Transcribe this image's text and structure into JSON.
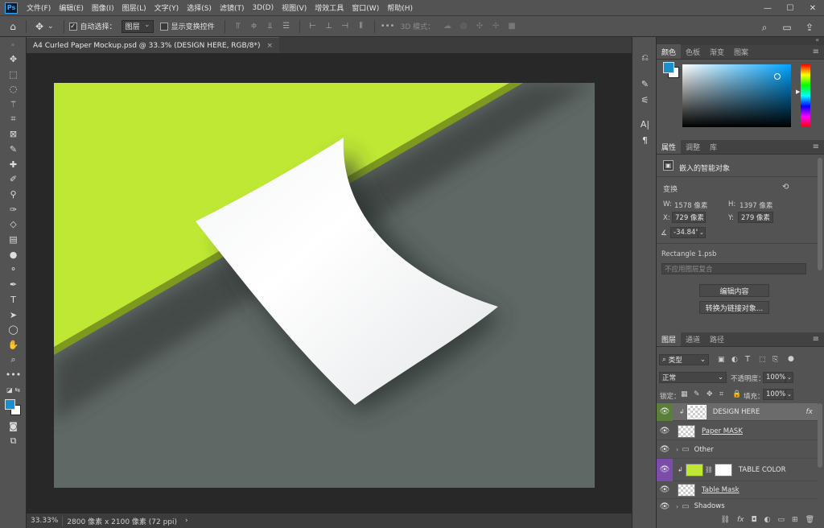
{
  "app": {
    "logo": "Ps"
  },
  "menu": [
    "文件(F)",
    "编辑(E)",
    "图像(I)",
    "图层(L)",
    "文字(Y)",
    "选择(S)",
    "滤镜(T)",
    "3D(D)",
    "视图(V)",
    "增效工具",
    "窗口(W)",
    "帮助(H)"
  ],
  "options": {
    "auto_select_label": "自动选择：",
    "auto_select_value": "图层",
    "show_transform_label": "显示变换控件",
    "mode_3d_label": "3D 模式："
  },
  "document": {
    "tab_title": "A4 Curled Paper Mockup.psd @ 33.3% (DESIGN HERE, RGB/8*)",
    "close_glyph": "×",
    "colors": {
      "green": "#bfe835",
      "gray": "#5f6865",
      "paper": "#ffffff"
    }
  },
  "status": {
    "zoom": "33.33%",
    "size": "2800 像素 x 2100 像素 (72 ppi)",
    "arrow": "›"
  },
  "color_panel": {
    "tabs": [
      "颜色",
      "色板",
      "渐变",
      "图案"
    ],
    "foreground": "#1a8fd0",
    "background": "#ffffff"
  },
  "properties": {
    "tabs": [
      "属性",
      "调整",
      "库"
    ],
    "type_label": "嵌入的智能对象",
    "transform_label": "变换",
    "w_label": "W:",
    "w_value": "1578 像素",
    "h_label": "H:",
    "h_value": "1397 像素",
    "x_label": "X:",
    "x_value": "729 像素",
    "y_label": "Y:",
    "y_value": "279 像素",
    "angle_value": "-34.84°",
    "source_file": "Rectangle 1.psb",
    "comp_placeholder": "不应用图层复合",
    "edit_button": "编辑内容",
    "convert_button": "转换为链接对象..."
  },
  "layers_panel": {
    "tabs": [
      "图层",
      "通道",
      "路径"
    ],
    "filter_label": "类型",
    "blend_mode": "正常",
    "opacity_label": "不透明度：",
    "opacity_value": "100%",
    "lock_label": "锁定：",
    "fill_label": "填充：",
    "fill_value": "100%",
    "layers": [
      {
        "name": "DESIGN HERE",
        "fx": "fx"
      },
      {
        "name": "Paper MASK"
      },
      {
        "name": "Other"
      },
      {
        "name": "TABLE COLOR"
      },
      {
        "name": "Table Mask"
      },
      {
        "name": "Shadows"
      }
    ]
  }
}
